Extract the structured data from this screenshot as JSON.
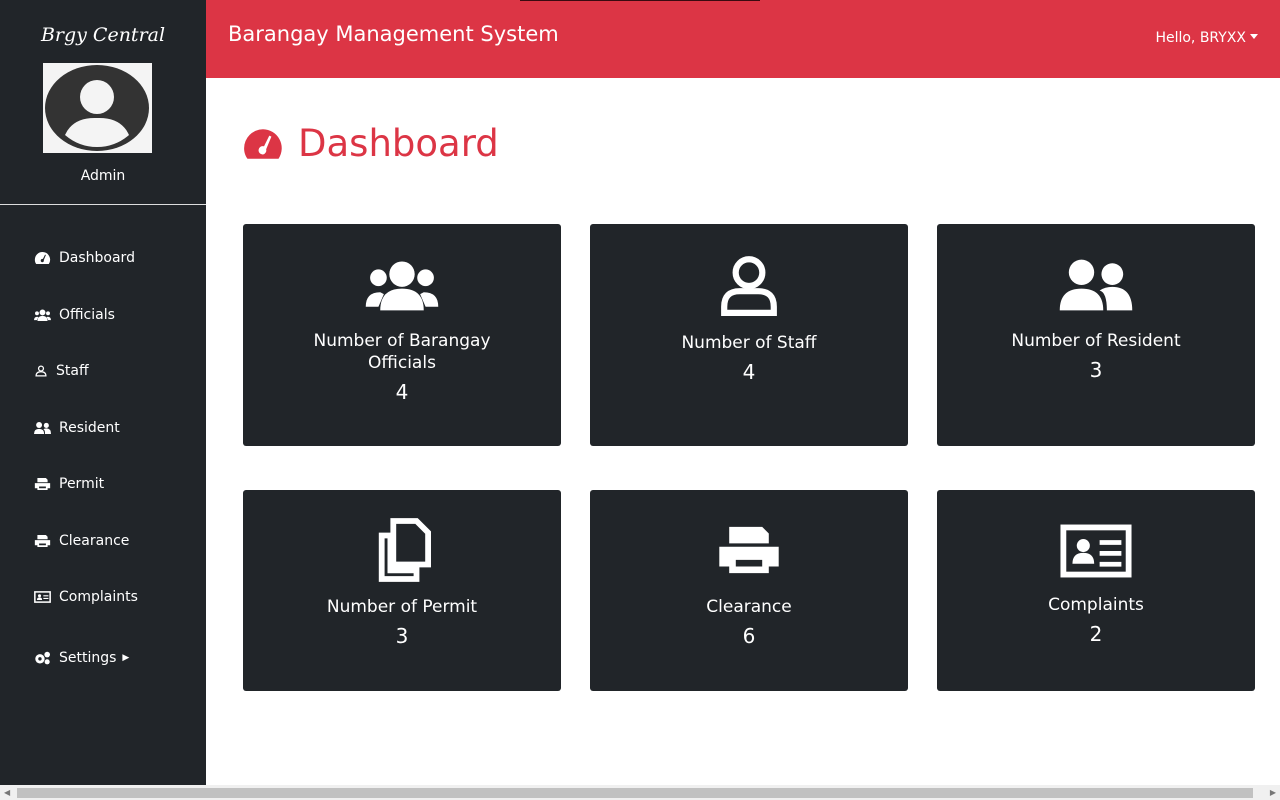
{
  "sidebar": {
    "brand": "Brgy Central",
    "role": "Admin",
    "items": [
      {
        "label": "Dashboard",
        "icon": "tachometer-icon"
      },
      {
        "label": "Officials",
        "icon": "users-icon"
      },
      {
        "label": "Staff",
        "icon": "user-icon"
      },
      {
        "label": "Resident",
        "icon": "user-friends-icon"
      },
      {
        "label": "Permit",
        "icon": "print-icon"
      },
      {
        "label": "Clearance",
        "icon": "print-icon"
      },
      {
        "label": "Complaints",
        "icon": "id-card-icon"
      },
      {
        "label": "Settings",
        "icon": "cogs-icon"
      }
    ]
  },
  "header": {
    "title": "Barangay Management System",
    "user": "Hello, BRYXX"
  },
  "main": {
    "title": "Dashboard",
    "cards": [
      {
        "label": "Number of Barangay Officials",
        "value": "4"
      },
      {
        "label": "Number of Staff",
        "value": "4"
      },
      {
        "label": "Number of Resident",
        "value": "3"
      },
      {
        "label": "Number of Permit",
        "value": "3"
      },
      {
        "label": "Clearance",
        "value": "6"
      },
      {
        "label": "Complaints",
        "value": "2"
      }
    ]
  },
  "colors": {
    "accent": "#dc3545",
    "dark": "#212529"
  }
}
